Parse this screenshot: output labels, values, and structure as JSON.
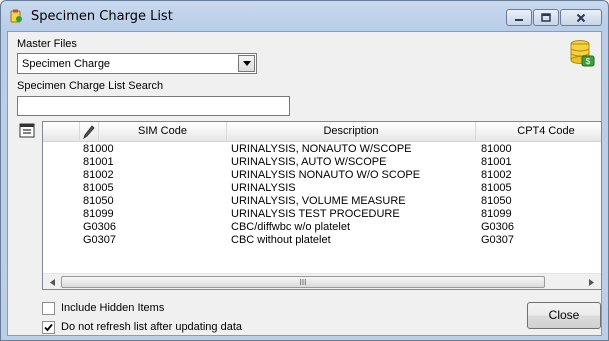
{
  "window": {
    "title": "Specimen Charge List",
    "minimize_label": "minimize",
    "maximize_label": "maximize",
    "close_label": "close"
  },
  "master_files": {
    "label": "Master Files",
    "selected": "Specimen Charge"
  },
  "search": {
    "label": "Specimen Charge List Search",
    "value": "",
    "placeholder": ""
  },
  "grid": {
    "columns": [
      "SIM Code",
      "Description",
      "CPT4 Code"
    ],
    "rows": [
      [
        "81000",
        "URINALYSIS, NONAUTO W/SCOPE",
        "81000"
      ],
      [
        "81001",
        "URINALYSIS, AUTO W/SCOPE",
        "81001"
      ],
      [
        "81002",
        "URINALYSIS NONAUTO W/O SCOPE",
        "81002"
      ],
      [
        "81005",
        "URINALYSIS",
        "81005"
      ],
      [
        "81050",
        "URINALYSIS, VOLUME MEASURE",
        "81050"
      ],
      [
        "81099",
        "URINALYSIS TEST PROCEDURE",
        "81099"
      ],
      [
        "G0306",
        "CBC/diffwbc w/o platelet",
        "G0306"
      ],
      [
        "G0307",
        "CBC without platelet",
        "G0307"
      ]
    ],
    "scroll_grip": "III"
  },
  "options": {
    "include_hidden_label": "Include Hidden Items",
    "include_hidden_checked": false,
    "no_refresh_label": "Do not refresh list after updating data",
    "no_refresh_checked": true
  },
  "actions": {
    "close_label": "Close"
  },
  "icons": {
    "title": "app-icon",
    "database": "database-icon",
    "column_chooser": "column-chooser-icon",
    "header_pen": "pen-icon"
  }
}
